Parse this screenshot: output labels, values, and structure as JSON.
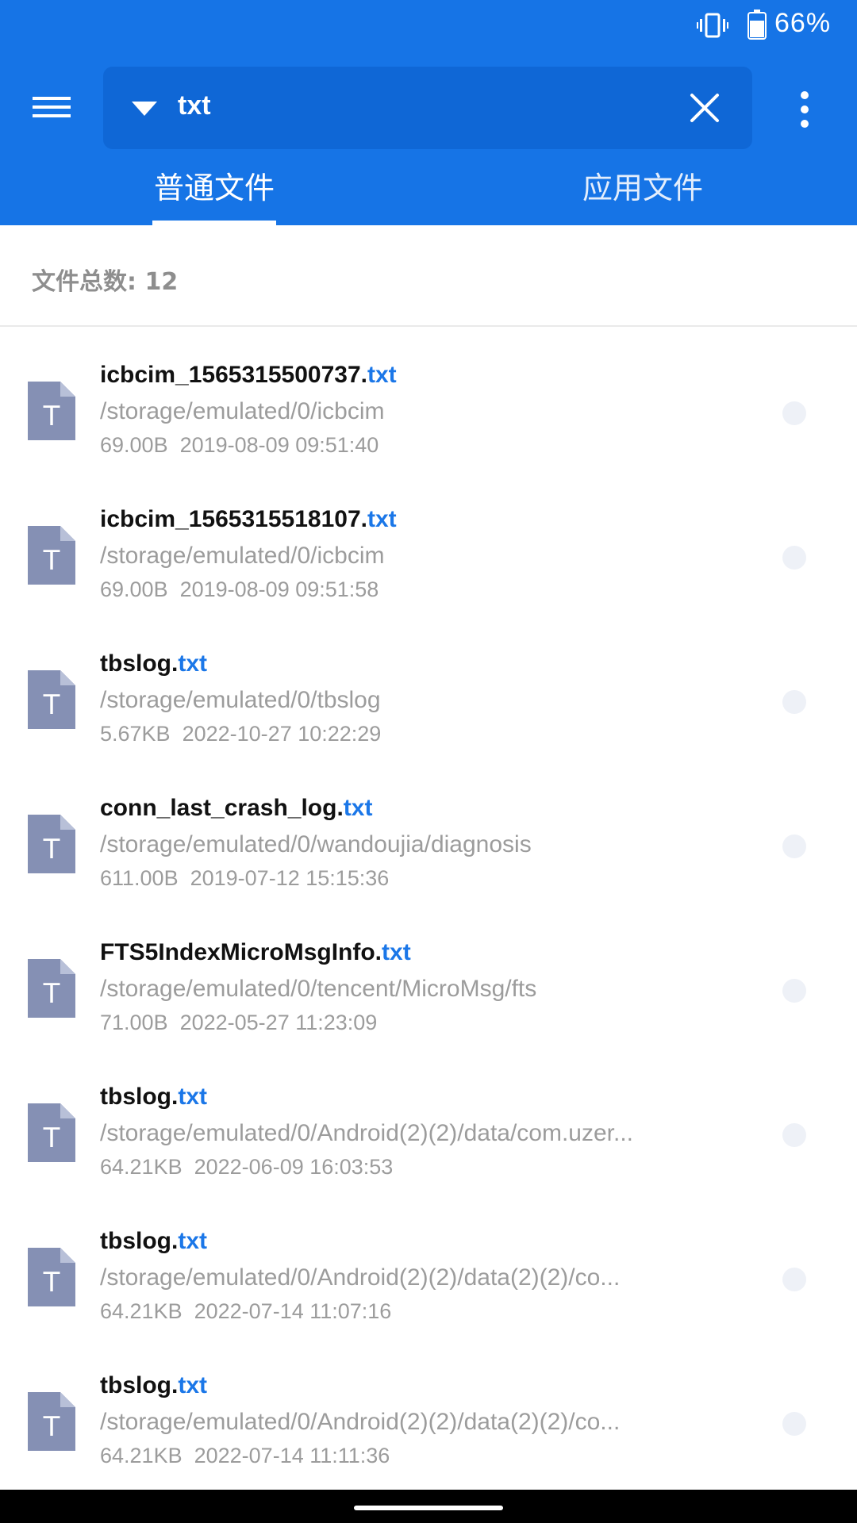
{
  "status_bar": {
    "battery": "66%"
  },
  "search": {
    "query": "txt"
  },
  "tabs": [
    {
      "label": "普通文件",
      "active": true
    },
    {
      "label": "应用文件",
      "active": false
    }
  ],
  "summary": {
    "total": "文件总数: 12"
  },
  "files": [
    {
      "name": "icbcim_1565315500737.",
      "ext": "txt",
      "path": "/storage/emulated/0/icbcim",
      "size": "69.00B",
      "date": "2019-08-09 09:51:40"
    },
    {
      "name": "icbcim_1565315518107.",
      "ext": "txt",
      "path": "/storage/emulated/0/icbcim",
      "size": "69.00B",
      "date": "2019-08-09 09:51:58"
    },
    {
      "name": "tbslog.",
      "ext": "txt",
      "path": "/storage/emulated/0/tbslog",
      "size": "5.67KB",
      "date": "2022-10-27 10:22:29"
    },
    {
      "name": "conn_last_crash_log.",
      "ext": "txt",
      "path": "/storage/emulated/0/wandoujia/diagnosis",
      "size": "611.00B",
      "date": "2019-07-12 15:15:36"
    },
    {
      "name": "FTS5IndexMicroMsgInfo.",
      "ext": "txt",
      "path": "/storage/emulated/0/tencent/MicroMsg/fts",
      "size": "71.00B",
      "date": "2022-05-27 11:23:09"
    },
    {
      "name": "tbslog.",
      "ext": "txt",
      "path": "/storage/emulated/0/Android(2)(2)/data/com.uzer...",
      "size": "64.21KB",
      "date": "2022-06-09 16:03:53"
    },
    {
      "name": "tbslog.",
      "ext": "txt",
      "path": "/storage/emulated/0/Android(2)(2)/data(2)(2)/co...",
      "size": "64.21KB",
      "date": "2022-07-14 11:07:16"
    },
    {
      "name": "tbslog.",
      "ext": "txt",
      "path": "/storage/emulated/0/Android(2)(2)/data(2)(2)/co...",
      "size": "64.21KB",
      "date": "2022-07-14 11:11:36"
    }
  ],
  "colors": {
    "header": "#1674E6",
    "search_box": "#0F67D6",
    "extension": "#1B77E8",
    "file_icon": "#8590B4"
  },
  "icons": {
    "status": [
      "vibrate-icon",
      "battery-icon"
    ],
    "toolbar": [
      "menu-icon",
      "dropdown-icon",
      "close-icon",
      "more-vert-icon"
    ],
    "file": "text-file-icon"
  }
}
